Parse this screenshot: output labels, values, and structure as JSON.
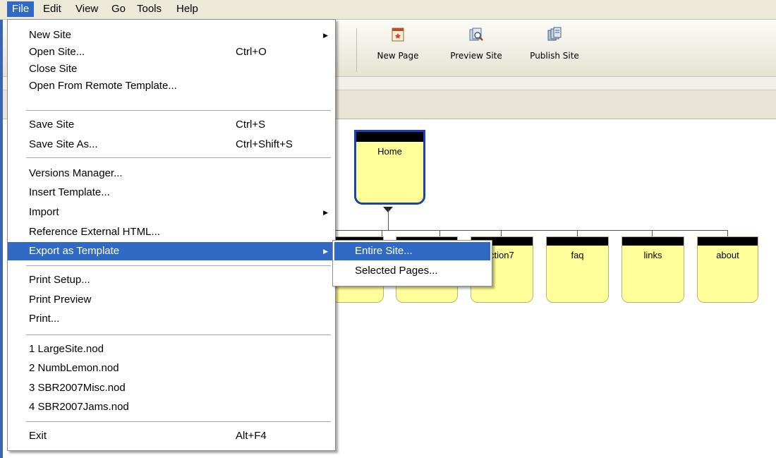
{
  "menubar": {
    "items": [
      "File",
      "Edit",
      "View",
      "Go",
      "Tools",
      "Help"
    ]
  },
  "toolbar": {
    "buttons": [
      {
        "label": "New Page",
        "icon": "new-page-icon"
      },
      {
        "label": "Preview Site",
        "icon": "preview-site-icon"
      },
      {
        "label": "Publish Site",
        "icon": "publish-site-icon"
      }
    ]
  },
  "file_menu": {
    "items": [
      {
        "label": "New Site",
        "shortcut": "",
        "submenu": true
      },
      {
        "label": "Open Site...",
        "shortcut": "Ctrl+O"
      },
      {
        "label": "Close Site",
        "shortcut": ""
      },
      {
        "label": "Open From Remote Template...",
        "shortcut": ""
      },
      {
        "label": "Save Site",
        "shortcut": "Ctrl+S"
      },
      {
        "label": "Save Site As...",
        "shortcut": "Ctrl+Shift+S"
      },
      {
        "label": "Versions Manager...",
        "shortcut": ""
      },
      {
        "label": "Insert Template...",
        "shortcut": ""
      },
      {
        "label": "Import",
        "shortcut": "",
        "submenu": true
      },
      {
        "label": "Reference External HTML...",
        "shortcut": ""
      },
      {
        "label": "Export as Template",
        "shortcut": "",
        "submenu": true,
        "highlighted": true
      },
      {
        "label": "Print Setup...",
        "shortcut": ""
      },
      {
        "label": "Print Preview",
        "shortcut": ""
      },
      {
        "label": "Print...",
        "shortcut": ""
      },
      {
        "label": "1 LargeSite.nod",
        "shortcut": ""
      },
      {
        "label": "2 NumbLemon.nod",
        "shortcut": ""
      },
      {
        "label": "3 SBR2007Misc.nod",
        "shortcut": ""
      },
      {
        "label": "4 SBR2007Jams.nod",
        "shortcut": ""
      },
      {
        "label": "Exit",
        "shortcut": "Alt+F4"
      }
    ]
  },
  "export_submenu": {
    "items": [
      {
        "label": "Entire Site...",
        "highlighted": true
      },
      {
        "label": "Selected Pages..."
      }
    ]
  },
  "sitemap": {
    "home": "Home",
    "pages": [
      "ction7",
      "faq",
      "links",
      "about"
    ]
  },
  "colors": {
    "highlight": "#316ac5",
    "node_fill": "#ffff99",
    "home_border": "#1f3fb8"
  }
}
